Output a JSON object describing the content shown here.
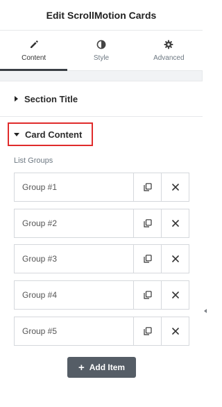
{
  "header": {
    "title": "Edit ScrollMotion Cards"
  },
  "tabs": [
    {
      "label": "Content",
      "icon": "pencil-icon",
      "active": true
    },
    {
      "label": "Style",
      "icon": "contrast-icon",
      "active": false
    },
    {
      "label": "Advanced",
      "icon": "gear-icon",
      "active": false
    }
  ],
  "sections": {
    "section_title": {
      "label": "Section Title",
      "icon": "caret-right-icon"
    },
    "card_content": {
      "label": "Card Content",
      "icon": "caret-down-icon"
    }
  },
  "list_groups": {
    "label": "List Groups",
    "items": [
      {
        "title": "Group #1"
      },
      {
        "title": "Group #2"
      },
      {
        "title": "Group #3"
      },
      {
        "title": "Group #4"
      },
      {
        "title": "Group #5"
      }
    ],
    "duplicate_icon": "duplicate-icon",
    "remove_icon": "close-icon"
  },
  "add_item": {
    "label": "Add Item",
    "icon": "plus-icon"
  },
  "colors": {
    "highlight_border": "#e02b2b",
    "button_bg": "#555d66",
    "active_tab_indicator": "#3a3f45"
  }
}
